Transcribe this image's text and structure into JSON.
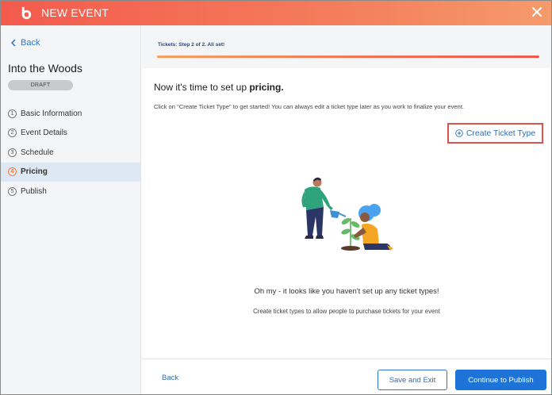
{
  "header": {
    "title": "NEW EVENT",
    "logo_icon": "brand-logo-icon",
    "close_icon": "close-icon"
  },
  "sidebar": {
    "back_label": "Back",
    "event_title": "Into the Woods",
    "badge": "DRAFT",
    "steps": [
      {
        "num": "1",
        "label": "Basic Information",
        "active": false
      },
      {
        "num": "2",
        "label": "Event Details",
        "active": false
      },
      {
        "num": "3",
        "label": "Schedule",
        "active": false
      },
      {
        "num": "4",
        "label": "Pricing",
        "active": true
      },
      {
        "num": "5",
        "label": "Publish",
        "active": false
      }
    ]
  },
  "progress": {
    "label": "Tickets: Step 2 of 2. All set!",
    "fraction": 1.0
  },
  "main": {
    "heading_prefix": "Now it's time to set up ",
    "heading_bold": "pricing.",
    "subtext": "Click on \"Create Ticket Type\" to get started! You can always edit a ticket type later as you work to finalize your event.",
    "create_button": "Create Ticket Type",
    "empty_title": "Oh my - it looks like you haven't set up any ticket types!",
    "empty_sub": "Create ticket types to allow people to purchase tickets for your event"
  },
  "footer": {
    "back_label": "Back",
    "save_label": "Save and Exit",
    "publish_label": "Continue to Publish"
  },
  "colors": {
    "accent_blue": "#1d73d8",
    "header_gradient_start": "#f35b4d",
    "header_gradient_end": "#f59a6b",
    "highlight_border": "#d9534f"
  }
}
